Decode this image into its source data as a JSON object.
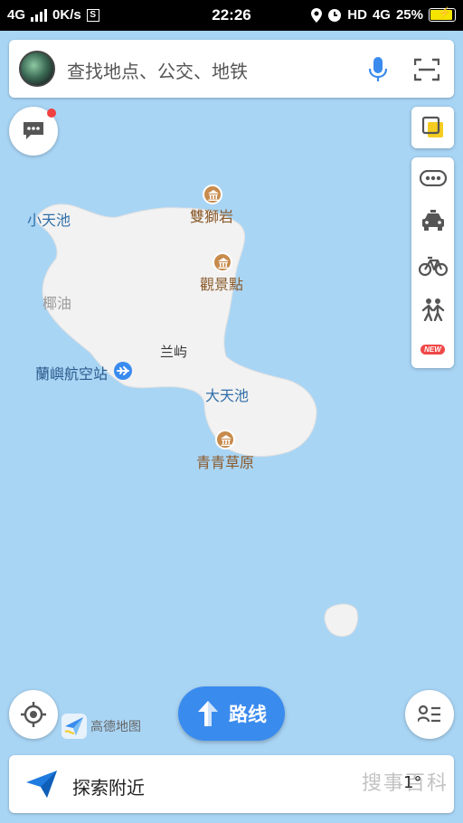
{
  "status_bar": {
    "network": "4G",
    "speed": "0K/s",
    "s_icon": "S",
    "time": "22:26",
    "hd": "HD",
    "network2": "4G",
    "battery": "25%",
    "battery_level": 0.25
  },
  "search": {
    "placeholder": "查找地点、公交、地铁"
  },
  "map": {
    "labels": {
      "xiao_tian_chi": "小天池",
      "shuang_shi_yan": "雙獅岩",
      "guan_jing_dian": "觀景點",
      "ye_you": "椰油",
      "lan_yu": "兰屿",
      "airport": "蘭嶼航空站",
      "da_tian_chi": "大天池",
      "qing_qing_cao_yuan": "青青草原"
    }
  },
  "toolbar": {
    "new_badge": "NEW"
  },
  "route_button": {
    "label": "路线"
  },
  "logo": {
    "text": "高德地图"
  },
  "explore": {
    "label": "探索附近",
    "temperature": "1°"
  },
  "watermark": "搜事百科"
}
